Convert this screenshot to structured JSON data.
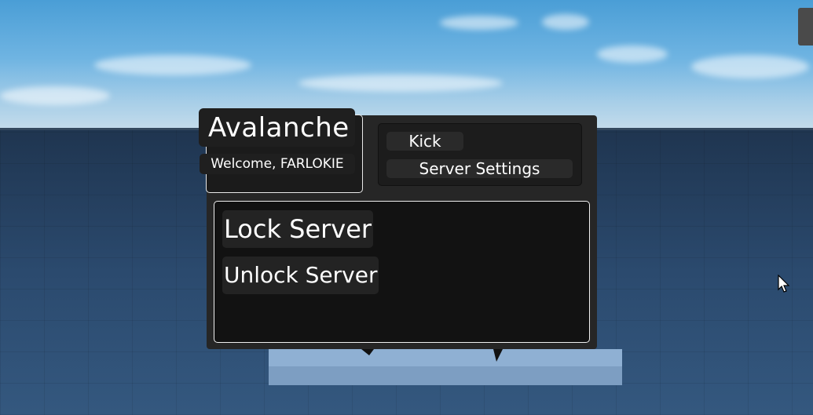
{
  "gui": {
    "title": "Avalanche",
    "welcome": "Welcome, FARLOKIE",
    "tabs": [
      {
        "label": "Kick"
      },
      {
        "label": "Server Settings"
      }
    ],
    "actions": [
      {
        "label": "Lock Server"
      },
      {
        "label": "Unlock Server"
      }
    ]
  },
  "colors": {
    "panel": "#262626",
    "content": "#121212",
    "text": "#ffffff",
    "border": "#f0f0f0"
  }
}
